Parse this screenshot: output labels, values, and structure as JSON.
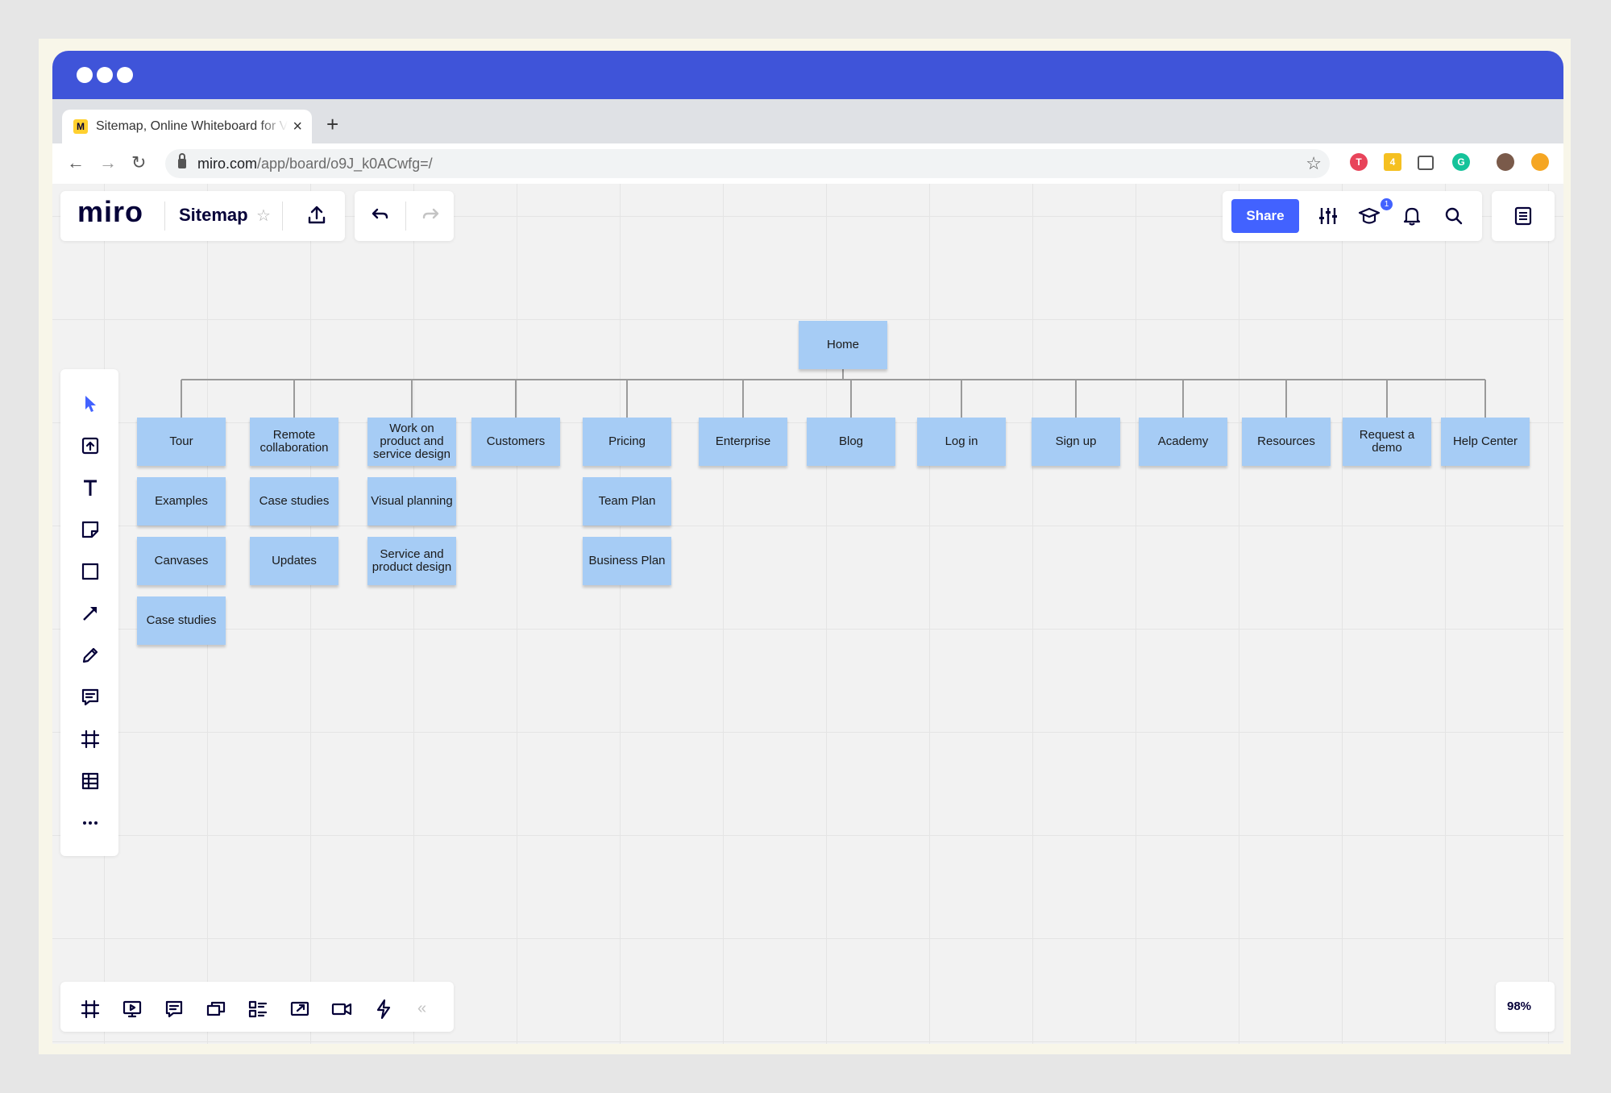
{
  "browser": {
    "tab_title": "Sitemap, Online Whiteboard for Visual Collaboration",
    "tab_favicon": "miro-favicon",
    "url_host": "miro.com",
    "url_path": "/app/board/o9J_k0ACwfg=/",
    "new_tab_label": "+",
    "close_tab_label": "×",
    "back_label": "←",
    "forward_label": "→",
    "reload_label": "↻",
    "bookmark_label": "☆",
    "titlebar_color": "#3f54d9"
  },
  "toolbar": {
    "logo": "miro",
    "board_name": "Sitemap",
    "star_label": "☆",
    "share_label": "Share",
    "notification_badge": "1",
    "accent_color": "#4262ff"
  },
  "left_tools": [
    "select-tool",
    "upload-tool",
    "text-tool",
    "sticky-note-tool",
    "shape-tool",
    "connection-line-tool",
    "pen-tool",
    "comment-tool",
    "frame-tool",
    "table-tool",
    "more-tools"
  ],
  "bottom_tools": [
    "frames-tool",
    "presentation-tool",
    "comments-tool",
    "cards-tool",
    "kanban-tool",
    "screen-share-tool",
    "video-chat-tool",
    "apps-tool"
  ],
  "bottom_collapse_label": "«",
  "zoom_level": "98%",
  "sitemap": {
    "root": "Home",
    "columns": [
      [
        "Tour",
        "Examples",
        "Canvases",
        "Case studies"
      ],
      [
        "Remote collaboration",
        "Case studies",
        "Updates"
      ],
      [
        "Work on product and service design",
        "Visual planning",
        "Service and product design"
      ],
      [
        "Customers"
      ],
      [
        "Pricing",
        "Team Plan",
        "Business Plan"
      ],
      [
        "Enterprise"
      ],
      [
        "Blog"
      ],
      [
        "Log in"
      ],
      [
        "Sign up"
      ],
      [
        "Academy"
      ],
      [
        "Resources"
      ],
      [
        "Request a demo"
      ],
      [
        "Help Center"
      ]
    ],
    "note_color": "#a6ccf5"
  }
}
